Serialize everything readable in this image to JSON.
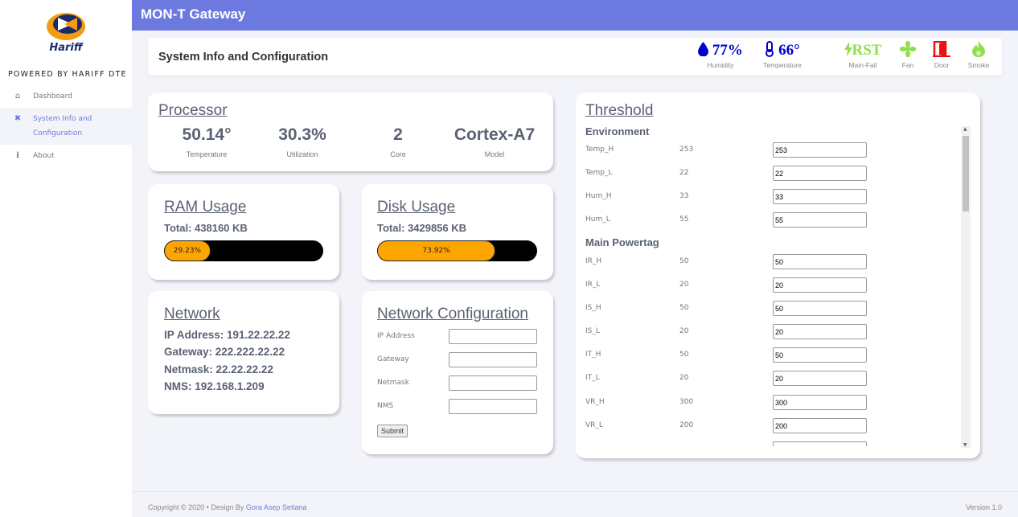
{
  "app": {
    "title": "MON-T Gateway"
  },
  "brand": {
    "logo_text": "Hariff",
    "powered_by": "POWERED BY HARIFF DTE"
  },
  "sidebar": {
    "items": [
      {
        "label": "Dashboard",
        "icon": "home-icon",
        "active": false
      },
      {
        "label": "System Info and Configuration",
        "icon": "wrench-icon",
        "active": true
      },
      {
        "label": "About",
        "icon": "info-icon",
        "active": false
      }
    ]
  },
  "header": {
    "page_title": "System Info and Configuration",
    "status": [
      {
        "value": "77%",
        "label": "Humidity",
        "icon": "droplet-icon",
        "color": "#0000cc"
      },
      {
        "value": "66°",
        "label": "Temperature",
        "icon": "thermometer-icon",
        "color": "#0000cc"
      },
      {
        "value": "RST",
        "label": "Main-Fail",
        "icon": "lightning-icon",
        "color": "#8ee04a"
      },
      {
        "value": "",
        "label": "Fan",
        "icon": "fan-icon",
        "color": "#8ee04a"
      },
      {
        "value": "",
        "label": "Door",
        "icon": "door-icon",
        "color": "#ee1111"
      },
      {
        "value": "",
        "label": "Smoke",
        "icon": "fire-icon",
        "color": "#8ee04a"
      }
    ]
  },
  "processor": {
    "title": "Processor",
    "stats": [
      {
        "value": "50.14°",
        "label": "Temperature"
      },
      {
        "value": "30.3%",
        "label": "Utilization"
      },
      {
        "value": "2",
        "label": "Core"
      },
      {
        "value": "Cortex-A7",
        "label": "Model"
      }
    ]
  },
  "ram": {
    "title": "RAM Usage",
    "total": "Total: 438160 KB",
    "percent_label": "29.23%",
    "percent": 29.23,
    "bar_color": "#ffa500"
  },
  "disk": {
    "title": "Disk Usage",
    "total": "Total: 3429856 KB",
    "percent_label": "73.92%",
    "percent": 73.92,
    "bar_color": "#ffa500"
  },
  "network": {
    "title": "Network",
    "ip": "IP Address: 191.22.22.22",
    "gateway": "Gateway: 222.222.22.22",
    "netmask": "Netmask: 22.22.22.22",
    "nms": "NMS: 192.168.1.209"
  },
  "netconfig": {
    "title": "Network Configuration",
    "fields": [
      {
        "label": "IP Address",
        "value": ""
      },
      {
        "label": "Gateway",
        "value": ""
      },
      {
        "label": "Netmask",
        "value": ""
      },
      {
        "label": "NMS",
        "value": ""
      }
    ],
    "submit_label": "Submit"
  },
  "threshold": {
    "title": "Threshold",
    "environment_label": "Environment",
    "environment": [
      {
        "name": "Temp_H",
        "current": "253",
        "value": "253"
      },
      {
        "name": "Temp_L",
        "current": "22",
        "value": "22"
      },
      {
        "name": "Hum_H",
        "current": "33",
        "value": "33"
      },
      {
        "name": "Hum_L",
        "current": "55",
        "value": "55"
      }
    ],
    "powertag_label": "Main Powertag",
    "powertag": [
      {
        "name": "IR_H",
        "current": "50",
        "value": "50"
      },
      {
        "name": "IR_L",
        "current": "20",
        "value": "20"
      },
      {
        "name": "IS_H",
        "current": "50",
        "value": "50"
      },
      {
        "name": "IS_L",
        "current": "20",
        "value": "20"
      },
      {
        "name": "IT_H",
        "current": "50",
        "value": "50"
      },
      {
        "name": "IT_L",
        "current": "20",
        "value": "20"
      },
      {
        "name": "VR_H",
        "current": "300",
        "value": "300"
      },
      {
        "name": "VR_L",
        "current": "200",
        "value": "200"
      }
    ]
  },
  "footer": {
    "copyright": "Copyright © 2020",
    "separator": "•",
    "designed_by": "Design By",
    "author": "Gora Asep Setiana",
    "version": "Version 1.0"
  },
  "theme": {
    "accent": "#6c7ae0",
    "background": "#f3f4f9"
  }
}
